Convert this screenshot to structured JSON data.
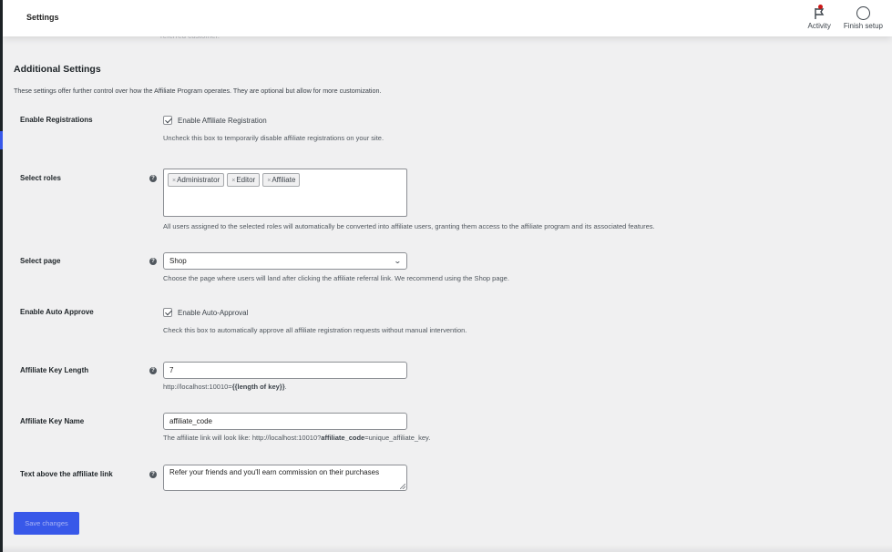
{
  "header": {
    "title": "Settings",
    "actions": [
      {
        "label": "Activity",
        "icon": "flag-icon",
        "has_notification": true,
        "notification_color": "#cc1818"
      },
      {
        "label": "Finish setup",
        "icon": "circle-icon"
      }
    ]
  },
  "scrolled_text": "referred customer.",
  "section": {
    "title": "Additional Settings",
    "description": "These settings offer further control over how the Affiliate Program operates. They are optional but allow for more customization."
  },
  "fields": {
    "enable_registrations": {
      "label": "Enable Registrations",
      "checkbox_label": "Enable Affiliate Registration",
      "checked": true,
      "description": "Uncheck this box to temporarily disable affiliate registrations on your site."
    },
    "select_roles": {
      "label": "Select roles",
      "selected": [
        "Administrator",
        "Editor",
        "Affiliate"
      ],
      "description": "All users assigned to the selected roles will automatically be converted into affiliate users, granting them access to the affiliate program and its associated features."
    },
    "select_page": {
      "label": "Select page",
      "value": "Shop",
      "description": "Choose the page where users will land after clicking the affiliate referral link. We recommend using the Shop page."
    },
    "enable_auto_approve": {
      "label": "Enable Auto Approve",
      "checkbox_label": "Enable Auto-Approval",
      "checked": true,
      "description": "Check this box to automatically approve all affiliate registration requests without manual intervention."
    },
    "affiliate_key_length": {
      "label": "Affiliate Key Length",
      "value": "7",
      "description_prefix": "http://localhost:10010=",
      "description_bold": "{{length of key}}",
      "description_suffix": "."
    },
    "affiliate_key_name": {
      "label": "Affiliate Key Name",
      "value": "affiliate_code",
      "description_prefix": "The affiliate link will look like: http://localhost:10010?",
      "description_bold": "affiliate_code",
      "description_suffix": "=unique_affiliate_key."
    },
    "text_above_link": {
      "label": "Text above the affiliate link",
      "value": "Refer your friends and you'll earn commission on their purchases"
    }
  },
  "save_button": {
    "label": "Save changes",
    "color": "#3858e9"
  },
  "help_icon_glyph": "?",
  "colors": {
    "accent": "#3858e9",
    "background": "#f0f0f1"
  }
}
